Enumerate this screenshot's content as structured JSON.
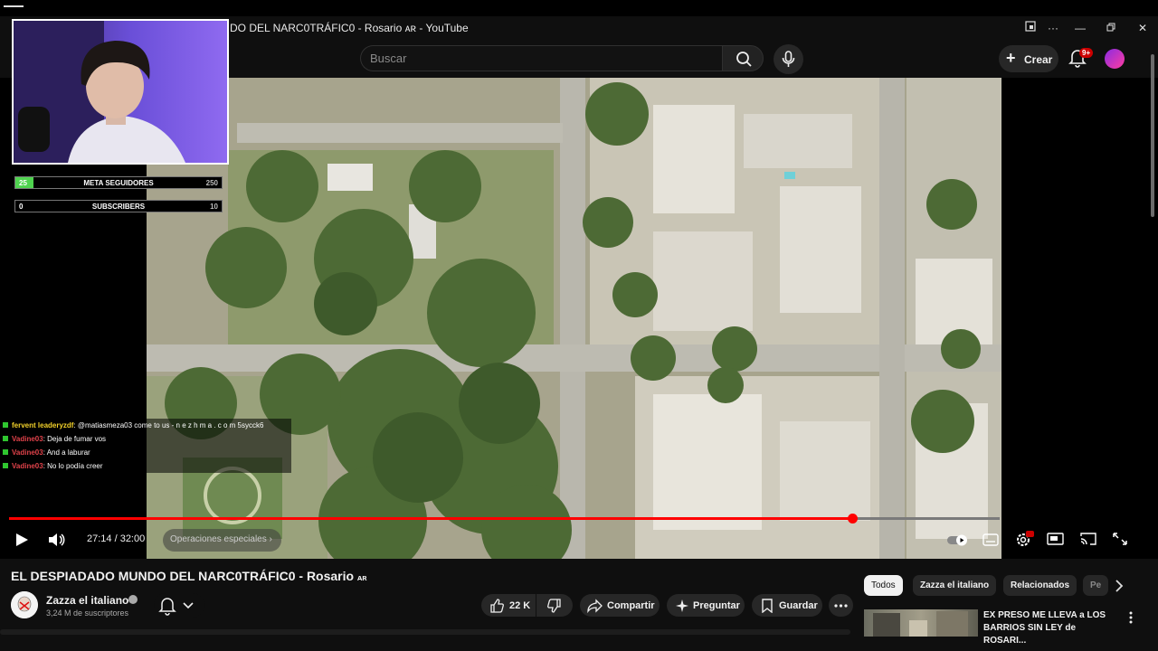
{
  "window": {
    "title": "DO DEL NARC0TRÁFIC0 - Rosario ᴀʀ - YouTube"
  },
  "masthead": {
    "search_placeholder": "Buscar",
    "create_label": "Crear",
    "notification_badge": "9+"
  },
  "stream_overlay": {
    "followers_goal": {
      "current": "25",
      "label": "META SEGUIDORES",
      "target": "250"
    },
    "subscribers_goal": {
      "current": "0",
      "label": "SUBSCRIBERS",
      "target": "10"
    },
    "chat": [
      {
        "user": "fervent leaderyzdf",
        "user_color": "#f2d12a",
        "message": ": @matiasmeza03 come to us - n e z h m a . c o m 5sycck6"
      },
      {
        "user": "Vadine03",
        "user_color": "#e0424a",
        "message": ": Deja de fumar vos"
      },
      {
        "user": "Vadine03",
        "user_color": "#e0424a",
        "message": ": And a laburar"
      },
      {
        "user": "Vadine03",
        "user_color": "#e0424a",
        "message": ": No lo podía creer"
      }
    ]
  },
  "player": {
    "time_current": "27:14",
    "time_total": "32:00",
    "time_display": "27:14 / 32:00",
    "progress_fraction": 0.851,
    "chapter": "Operaciones especiales",
    "settings_badge": "4K",
    "accent_color": "#ff0000"
  },
  "video": {
    "title": "EL DESPIADADO MUNDO DEL NARC0TRÁFIC0 - Rosario",
    "title_suffix": "ᴀʀ",
    "channel_name": "Zazza el italiano",
    "subscribers": "3,24 M de suscriptores",
    "likes": "22 K",
    "share_label": "Compartir",
    "ask_label": "Preguntar",
    "save_label": "Guardar"
  },
  "filter_chips": [
    "Todos",
    "Zazza el italiano",
    "Relacionados",
    "Pe"
  ],
  "recommendation": {
    "title": "EX PRESO ME LLEVA a LOS BARRIOS SIN LEY de ROSARI..."
  }
}
